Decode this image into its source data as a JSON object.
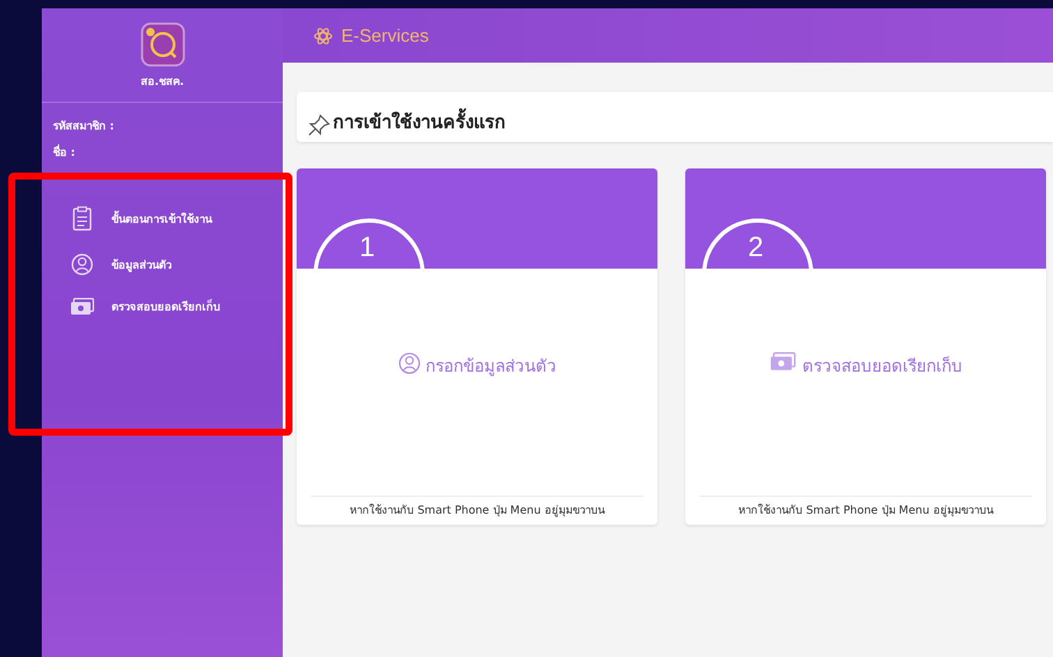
{
  "sidebar": {
    "logo_text": "สอ.ชสค.",
    "member_id_label": "รหัสสมาชิก :",
    "name_label": "ชื่อ :",
    "items": [
      {
        "label": "ขั้นตอนการเข้าใช้งาน",
        "kind": "clipboard"
      },
      {
        "label": "ข้อมูลส่วนตัว",
        "kind": "user"
      },
      {
        "label": "ตรวจสอบยอดเรียกเก็บ",
        "kind": "money"
      }
    ]
  },
  "header": {
    "title": "E-Services"
  },
  "section": {
    "title": "การเข้าใช้งานครั้งแรก"
  },
  "steps": [
    {
      "number": "1",
      "label": "กรอกข้อมูลส่วนตัว",
      "kind": "user",
      "footer": "หากใช้งานกับ Smart Phone ปุ่ม Menu อยู่มุมขวาบน"
    },
    {
      "number": "2",
      "label": "ตรวจสอบยอดเรียกเก็บ",
      "kind": "money",
      "footer": "หากใช้งานกับ Smart Phone ปุ่ม Menu อยู่มุมขวาบน"
    }
  ]
}
